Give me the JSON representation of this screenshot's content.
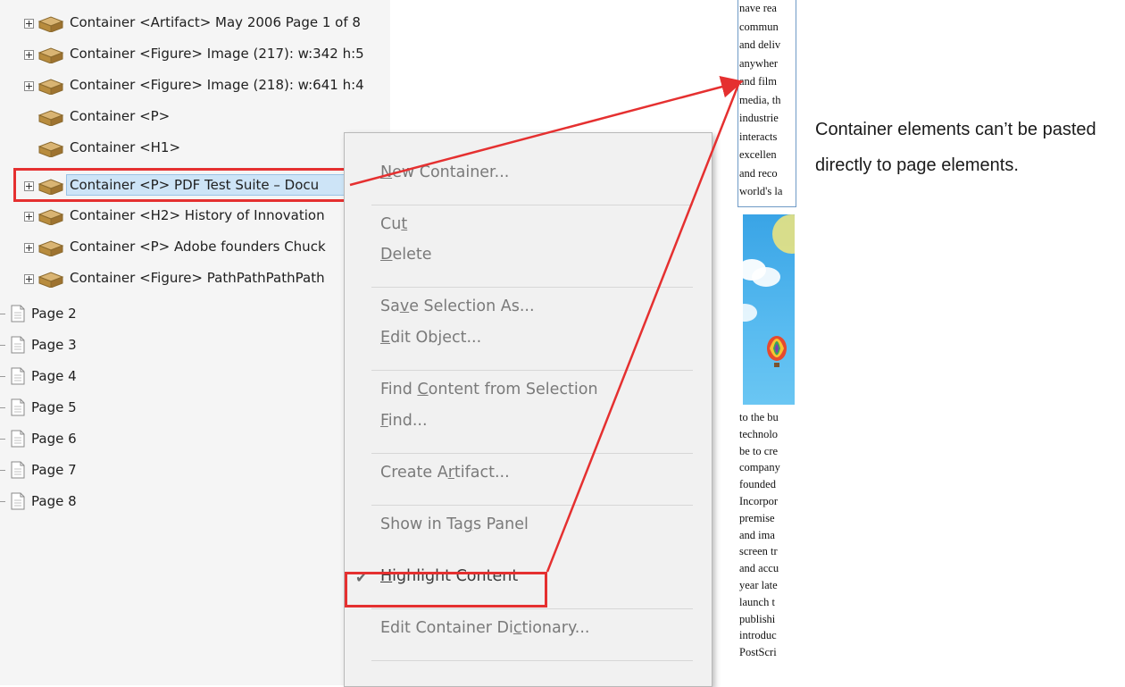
{
  "tree": {
    "containers": [
      {
        "label": "Container <Artifact> May 2006 Page 1 of 8",
        "expandable": true
      },
      {
        "label": "Container <Figure> Image (217): w:342 h:5",
        "expandable": true
      },
      {
        "label": "Container <Figure> Image (218): w:641 h:4",
        "expandable": true
      },
      {
        "label": "Container <P>",
        "expandable": false
      },
      {
        "label": "Container <H1>",
        "expandable": false
      },
      {
        "label": "Container <P> PDF Test Suite – Docu",
        "expandable": true,
        "selected": true
      },
      {
        "label": "Container <H2> History of Innovation",
        "expandable": true
      },
      {
        "label": "Container <P> Adobe founders Chuck",
        "expandable": true
      },
      {
        "label": "Container <Figure> PathPathPathPath",
        "expandable": true
      }
    ],
    "pages": [
      "Page 2",
      "Page 3",
      "Page 4",
      "Page 5",
      "Page 6",
      "Page 7",
      "Page 8"
    ]
  },
  "context_menu": {
    "items": [
      {
        "pre": "",
        "u": "N",
        "post": "ew Container...",
        "enabled": false
      },
      {
        "pre": "Cu",
        "u": "t",
        "post": "",
        "enabled": false
      },
      {
        "pre": "",
        "u": "D",
        "post": "elete",
        "enabled": false
      },
      {
        "pre": "Sa",
        "u": "v",
        "post": "e Selection As...",
        "enabled": false
      },
      {
        "pre": "",
        "u": "E",
        "post": "dit Object...",
        "enabled": false
      },
      {
        "pre": "Find ",
        "u": "C",
        "post": "ontent from Selection",
        "enabled": false
      },
      {
        "pre": "",
        "u": "F",
        "post": "ind...",
        "enabled": false
      },
      {
        "pre": "Create A",
        "u": "r",
        "post": "tifact...",
        "enabled": false
      },
      {
        "pre": "Show in Ta",
        "u": "g",
        "post": "s Panel",
        "enabled": false
      },
      {
        "pre": "",
        "u": "H",
        "post": "ighlight Content",
        "enabled": true,
        "checked": true
      },
      {
        "pre": "Edit Container Di",
        "u": "c",
        "post": "tionary...",
        "enabled": false
      }
    ],
    "check_glyph": "✔"
  },
  "document_preview": {
    "top_lines": [
      "nave rea",
      "commun",
      "and deliv",
      "anywher",
      "and film",
      "media, th",
      "industrie",
      "interacts",
      "excellen",
      "and reco",
      "world's la"
    ],
    "bottom_lines": [
      "to the bu",
      "technolo",
      "be to cre",
      "company",
      "founded",
      "Incorpor",
      "premise",
      "and ima",
      "screen tr",
      "and accu",
      "year late",
      "launch t",
      "publishi",
      "introduc",
      "PostScri"
    ]
  },
  "annotation": {
    "text": "Container elements can’t be pasted directly to page elements."
  },
  "colors": {
    "selection_fill": "#cde4f7",
    "annotation_red": "#e53030",
    "menu_background": "#f1f1f1"
  }
}
